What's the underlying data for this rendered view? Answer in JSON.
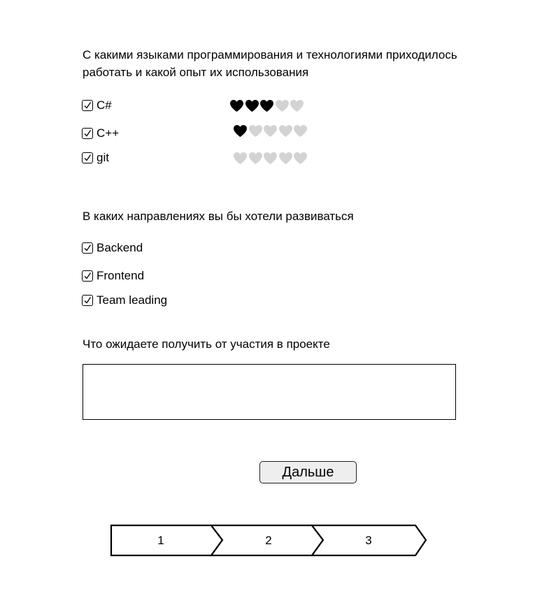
{
  "question_languages": {
    "title": "С какими языками программирования и технологиями приходилось работать и какой опыт их использования",
    "items": [
      {
        "label": "C#",
        "checked": true,
        "rating": 3,
        "max": 5
      },
      {
        "label": "C++",
        "checked": true,
        "rating": 1,
        "max": 5
      },
      {
        "label": "git",
        "checked": true,
        "rating": 0,
        "max": 5
      }
    ]
  },
  "question_directions": {
    "title": "В каких направлениях вы бы хотели развиваться",
    "items": [
      {
        "label": "Backend",
        "checked": true
      },
      {
        "label": "Frontend",
        "checked": true
      },
      {
        "label": "Team leading",
        "checked": true
      }
    ]
  },
  "question_expectations": {
    "title": "Что ожидаете получить от участия в проекте",
    "value": ""
  },
  "next_button": {
    "label": "Дальше"
  },
  "steps": [
    "1",
    "2",
    "3"
  ],
  "colors": {
    "heart_on": "#000000",
    "heart_off": "#d3d3d3",
    "button_bg": "#eeeeee"
  }
}
